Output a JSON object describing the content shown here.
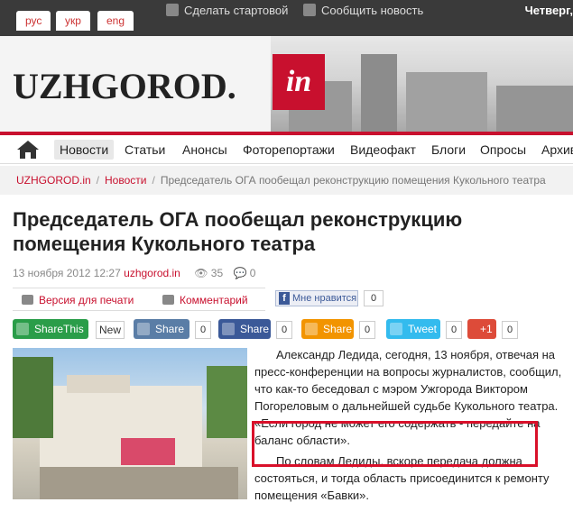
{
  "topbar": {
    "languages": [
      "рус",
      "укр",
      "eng"
    ],
    "start_page": "Сделать стартовой",
    "report_news": "Сообщить новость",
    "date": "Четверг,"
  },
  "logo": {
    "main": "UZHGOROD.",
    "suffix": "in"
  },
  "nav": {
    "items": [
      "Новости",
      "Статьи",
      "Анонсы",
      "Фоторепортажи",
      "Видеофакт",
      "Блоги",
      "Опросы",
      "Архив"
    ]
  },
  "breadcrumb": {
    "home": "UZHGOROD.in",
    "section": "Новости",
    "current": "Председатель ОГА пообещал реконструкцию помещения Кукольного театра"
  },
  "article": {
    "title": "Председатель ОГА пообещал реконструкцию помещения Кукольного театра",
    "datetime": "13 ноября 2012 12:27",
    "author": "uzhgorod.in",
    "views": "35",
    "comments": "0",
    "paragraph1": "Александр Ледида, сегодня, 13 ноября, отвечая на пресс-конференции на вопросы журналистов, сообщил, что как-то беседовал с мэром Ужгорода Виктором Погореловым о дальнейшей судьбе Кукольного театра. «Если город не может его содержать - передайте на баланс области».",
    "paragraph2": "По словам Ледиды, вскоре передача должна состояться, и тогда область присоединится к ремонту помещения «Бавки»."
  },
  "tools": {
    "print": "Версия для печати",
    "comment": "Комментарий"
  },
  "facebook": {
    "label": "Мне нравится",
    "count": "0"
  },
  "share": {
    "sharethis": "ShareThis",
    "new": "New",
    "vk": "Share",
    "vk_count": "0",
    "fb": "Share",
    "fb_count": "0",
    "ok": "Share",
    "ok_count": "0",
    "tweet": "Tweet",
    "tweet_count": "0",
    "gplus": "+1",
    "gplus_count": "0"
  },
  "colors": {
    "brand": "#c8102e",
    "highlight": "#d9102a"
  }
}
